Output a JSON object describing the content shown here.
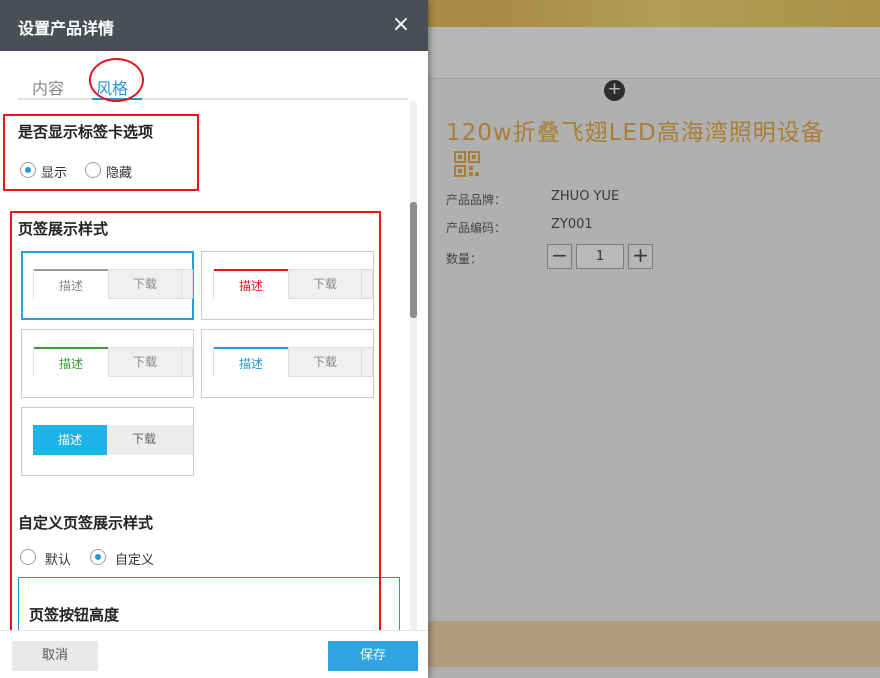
{
  "modal": {
    "title": "设置产品详情",
    "close_glyph": "×",
    "tabs": [
      {
        "label": "内容"
      },
      {
        "label": "风格"
      }
    ],
    "section_show_tabs": {
      "title": "是否显示标签卡选项",
      "options": [
        {
          "label": "显示",
          "selected": true
        },
        {
          "label": "隐藏",
          "selected": false
        }
      ]
    },
    "section_tab_style": {
      "title": "页签展示样式",
      "styles": [
        {
          "first": "描述",
          "second": "下载",
          "accent": "#999999",
          "selected": true
        },
        {
          "first": "描述",
          "second": "下载",
          "accent": "#e0191f",
          "selected": false
        },
        {
          "first": "描述",
          "second": "下载",
          "accent": "#3a9a3a",
          "selected": false
        },
        {
          "first": "描述",
          "second": "下载",
          "accent": "#2597d8",
          "selected": false
        },
        {
          "first": "描述",
          "second": "下载",
          "accent": "#1bb3e8",
          "selected": false
        }
      ]
    },
    "section_custom": {
      "title": "自定义页签展示样式",
      "options": [
        {
          "label": "默认",
          "selected": false
        },
        {
          "label": "自定义",
          "selected": true
        }
      ],
      "sub_title": "页签按钮高度"
    },
    "footer": {
      "cancel_label": "取消",
      "save_label": "保存"
    }
  },
  "background": {
    "plus_glyph": "+",
    "product_title": "120w折叠飞翅LED高海湾照明设备",
    "fields": [
      {
        "label": "产品品牌：",
        "value": "ZHUO YUE"
      },
      {
        "label": "产品编码：",
        "value": "ZY001"
      }
    ],
    "quantity": {
      "label": "数量：",
      "value": "1",
      "minus": "−",
      "plus": "+"
    }
  },
  "colors": {
    "accent": "#2597d8",
    "annotation": "#e0191f",
    "header": "#4a4e55",
    "title_orange": "#e4a02b"
  }
}
